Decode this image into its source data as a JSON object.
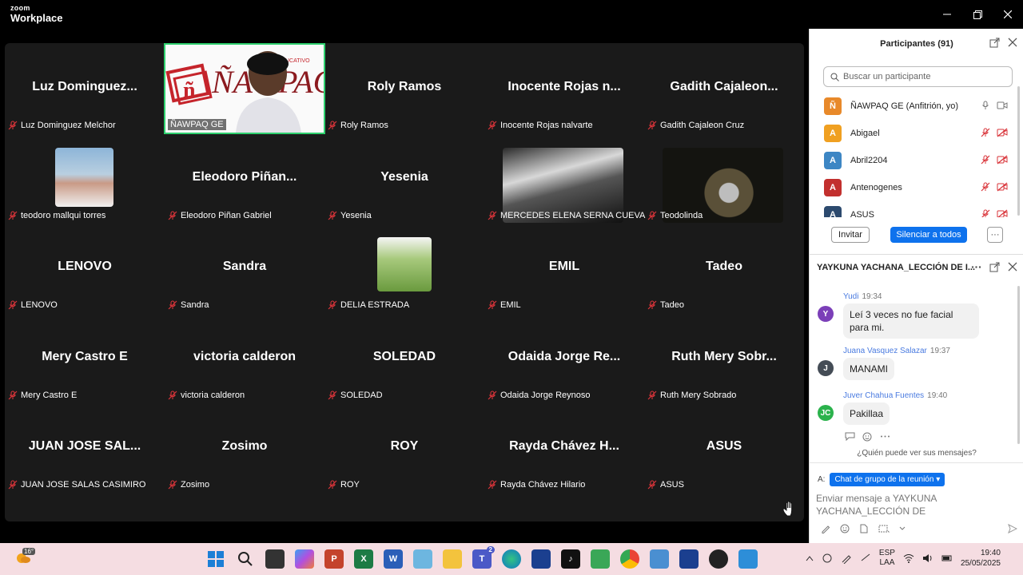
{
  "app": {
    "brand_top": "zoom",
    "brand_bottom": "Workplace"
  },
  "tiles": [
    {
      "big": "Luz Dominguez...",
      "label": "Luz Dominguez Melchor"
    },
    {
      "big": "",
      "label": "ÑAWPAQ GE",
      "host": true
    },
    {
      "big": "Roly Ramos",
      "label": "Roly Ramos"
    },
    {
      "big": "Inocente Rojas n...",
      "label": "Inocente Rojas nalvarte"
    },
    {
      "big": "Gadith Cajaleon...",
      "label": "Gadith Cajaleon Cruz"
    },
    {
      "big": "",
      "label": "teodoro mallqui torres"
    },
    {
      "big": "Eleodoro Piñan...",
      "label": "Eleodoro Piñan Gabriel"
    },
    {
      "big": "Yesenia",
      "label": "Yesenia"
    },
    {
      "big": "",
      "label": "MERCEDES ELENA SERNA CUEVA"
    },
    {
      "big": "",
      "label": "Teodolinda"
    },
    {
      "big": "LENOVO",
      "label": "LENOVO"
    },
    {
      "big": "Sandra",
      "label": "Sandra"
    },
    {
      "big": "",
      "label": "DELIA ESTRADA"
    },
    {
      "big": "EMIL",
      "label": "EMIL"
    },
    {
      "big": "Tadeo",
      "label": "Tadeo"
    },
    {
      "big": "Mery Castro E",
      "label": "Mery Castro E"
    },
    {
      "big": "victoria calderon",
      "label": "victoria calderon"
    },
    {
      "big": "SOLEDAD",
      "label": "SOLEDAD"
    },
    {
      "big": "Odaida Jorge Re...",
      "label": "Odaida Jorge Reynoso"
    },
    {
      "big": "Ruth Mery Sobr...",
      "label": "Ruth Mery Sobrado"
    },
    {
      "big": "JUAN JOSE SAL...",
      "label": "JUAN JOSE SALAS CASIMIRO"
    },
    {
      "big": "Zosimo",
      "label": "Zosimo"
    },
    {
      "big": "ROY",
      "label": "ROY"
    },
    {
      "big": "Rayda Chávez H...",
      "label": "Rayda Chávez Hilario"
    },
    {
      "big": "ASUS",
      "label": "ASUS"
    }
  ],
  "host_banner": {
    "logo_letter": "ñ",
    "brand": "ÑAWPAQ",
    "tagline": "UCATIVO"
  },
  "participants": {
    "title": "Participantes (91)",
    "search_placeholder": "Buscar un participante",
    "list": [
      {
        "initial": "Ñ",
        "color": "#e8892a",
        "name": "ÑAWPAQ GE (Anfitrión, yo)"
      },
      {
        "initial": "A",
        "color": "#f0a021",
        "name": "Abigael"
      },
      {
        "initial": "A",
        "color": "#3d86c4",
        "name": "Abril2204"
      },
      {
        "initial": "A",
        "color": "#c2302e",
        "name": "Antenogenes"
      },
      {
        "initial": "A",
        "color": "#2c4a6e",
        "name": "ASUS"
      }
    ],
    "invite": "Invitar",
    "mute_all": "Silenciar a todos",
    "more": "···"
  },
  "chat": {
    "title": "YAYKUNA YACHANA_LECCIÓN DE I...",
    "messages": [
      {
        "initial": "Y",
        "color": "#7b3fb8",
        "author": "Yudi",
        "time": "19:34",
        "text": "Leí 3 veces no fue facial para mi."
      },
      {
        "initial": "J",
        "color": "#444c56",
        "author": "Juana Vasquez Salazar",
        "time": "19:37",
        "text": "MANAMI"
      },
      {
        "initial": "JC",
        "color": "#2bb24c",
        "author": "Juver Chahua Fuentes",
        "time": "19:40",
        "text": "Pakillaa"
      }
    ],
    "who_can_see": "¿Quién puede ver sus mensajes?",
    "to_label": "A:",
    "to_value": "Chat de grupo de la reunión",
    "compose_placeholder": "Enviar mensaje a YAYKUNA YACHANA_LECCIÓN DE"
  },
  "taskbar": {
    "temp": "16°",
    "badge": "2",
    "lang1": "ESP",
    "lang2": "LAA",
    "time": "19:40",
    "date": "25/05/2025"
  },
  "colors": {
    "accent": "#0e72ed",
    "speaker_border": "#2ed06e",
    "muted_red": "#d9343a",
    "tile_bg": "#1a1a1a"
  }
}
